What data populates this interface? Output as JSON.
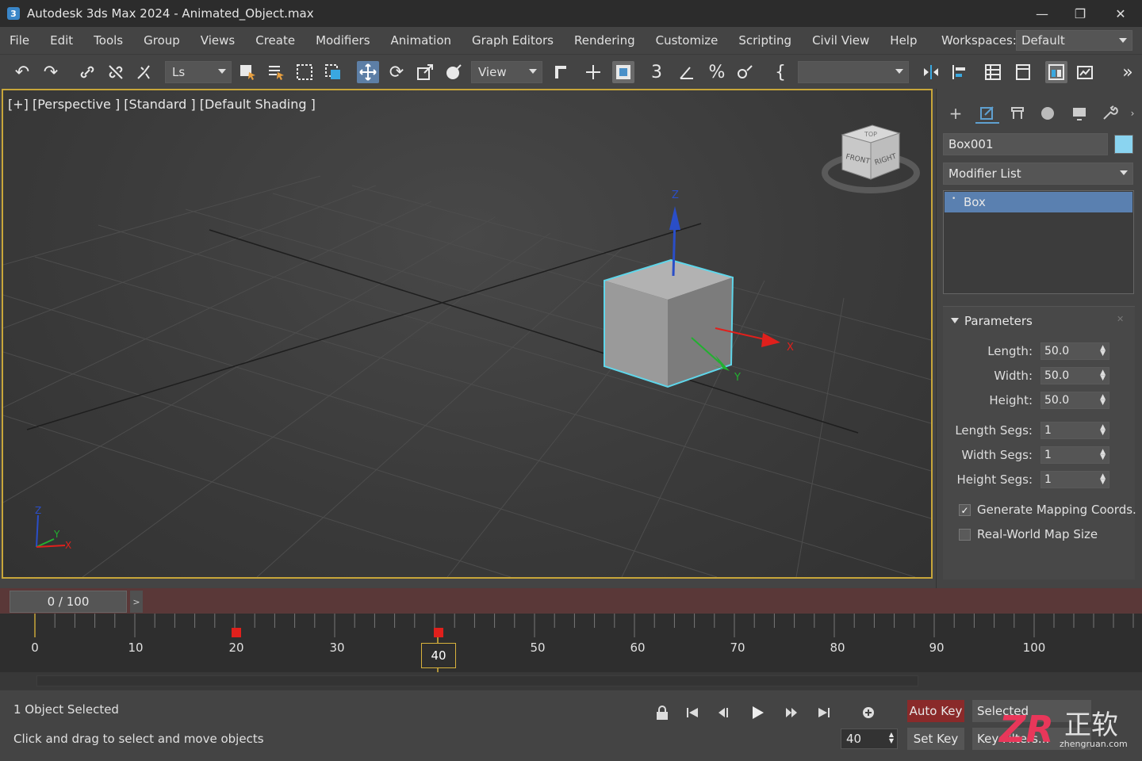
{
  "window": {
    "app_icon_text": "3",
    "title": "Autodesk 3ds Max 2024  -  Animated_Object.max",
    "controls": {
      "minimize": "—",
      "maximize": "❐",
      "close": "✕"
    }
  },
  "menu": {
    "items": [
      "File",
      "Edit",
      "Tools",
      "Group",
      "Views",
      "Create",
      "Modifiers",
      "Animation",
      "Graph Editors",
      "Rendering",
      "Customize",
      "Scripting",
      "Civil View",
      "Help"
    ],
    "workspaces_label": "Workspaces:",
    "workspaces_value": "Default"
  },
  "toolbar": {
    "selection_set_value": "Ls",
    "reference_coord_value": "View",
    "named_selection_value": "",
    "active_tool": "select-and-move",
    "overflow": "»"
  },
  "viewport": {
    "label": "[+] [Perspective ] [Standard ] [Default Shading ]",
    "viewcube_faces": {
      "front": "FRONT",
      "right": "RIGHT",
      "top": "TOP"
    },
    "gizmo_axes": {
      "x": "X",
      "y": "Y",
      "z": "Z"
    },
    "corner_axes": {
      "x": "X",
      "y": "Y",
      "z": "Z"
    },
    "selection_color": "#5fd6ea",
    "border_color": "#c8a63a"
  },
  "command_panel": {
    "object_name": "Box001",
    "object_color": "#8ad4f0",
    "modifier_list_label": "Modifier List",
    "stack_items": [
      "Box"
    ],
    "rollout_title": "Parameters",
    "params": [
      {
        "label": "Length:",
        "value": "50.0"
      },
      {
        "label": "Width:",
        "value": "50.0"
      },
      {
        "label": "Height:",
        "value": "50.0"
      },
      {
        "label": "Length Segs:",
        "value": "1"
      },
      {
        "label": "Width Segs:",
        "value": "1"
      },
      {
        "label": "Height Segs:",
        "value": "1"
      }
    ],
    "checkboxes": [
      {
        "label": "Generate Mapping Coords.",
        "checked": true
      },
      {
        "label": "Real-World Map Size",
        "checked": false
      }
    ]
  },
  "timeline": {
    "slider_label": "0 / 100",
    "next_arrow": ">",
    "frame_labels": [
      "0",
      "10",
      "20",
      "30",
      "50",
      "60",
      "70",
      "80",
      "90",
      "100"
    ],
    "current_frame": "40",
    "keyframes": [
      20,
      40
    ],
    "key_color": "#e0201c"
  },
  "status": {
    "selection": "1 Object Selected",
    "prompt": "Click and drag to select and move objects",
    "auto_key": "Auto Key",
    "selected_btn": "Selected",
    "set_key": "Set Key",
    "key_filters": "Key Filters...",
    "frame_value": "40"
  },
  "watermark": {
    "logo": "ZR",
    "chinese": "正软",
    "site": "zhengruan.com"
  }
}
